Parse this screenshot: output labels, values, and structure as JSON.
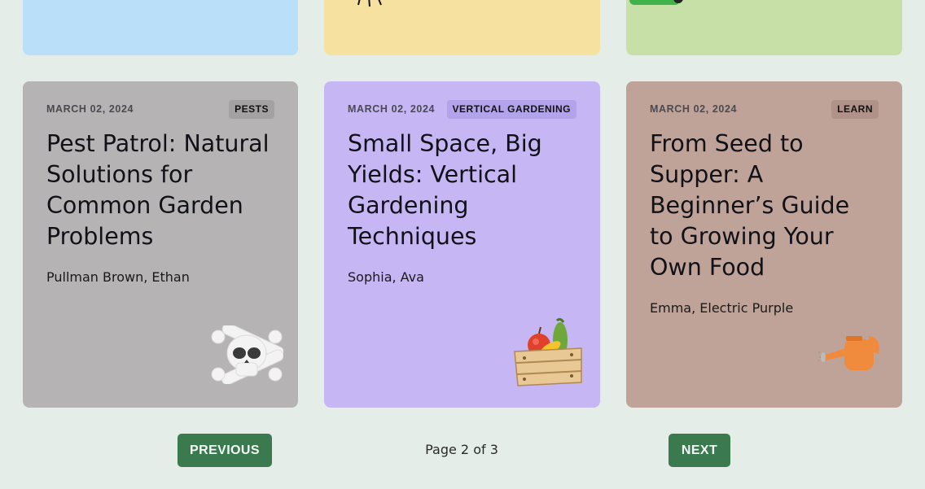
{
  "top_cards": [
    {
      "icon": "garden-hose-icon",
      "color": "#b9e0f8"
    },
    {
      "icon": "bee-icon",
      "color": "#f7e1a1"
    },
    {
      "icon": "recycle-bin-icon",
      "color": "#c6e0a7"
    }
  ],
  "cards": [
    {
      "date": "MARCH 02, 2024",
      "tag": "PESTS",
      "title": "Pest Patrol: Natural Solutions for Common Garden Problems",
      "author": "Pullman Brown, Ethan",
      "icon": "skull-crossbones-icon",
      "color": "#b5b3b3"
    },
    {
      "date": "MARCH 02, 2024",
      "tag": "VERTICAL GARDENING",
      "title": "Small Space, Big Yields: Vertical Gardening Techniques",
      "author": "Sophia, Ava",
      "icon": "produce-crate-icon",
      "color": "#c6b7f4"
    },
    {
      "date": "MARCH 02, 2024",
      "tag": "LEARN",
      "title": "From Seed to Supper: A Beginner’s Guide to Growing Your Own Food",
      "author": "Emma, Electric Purple",
      "icon": "watering-can-icon",
      "color": "#bfa399"
    }
  ],
  "pagination": {
    "previous_label": "PREVIOUS",
    "next_label": "NEXT",
    "page_text": "Page 2 of 3"
  }
}
